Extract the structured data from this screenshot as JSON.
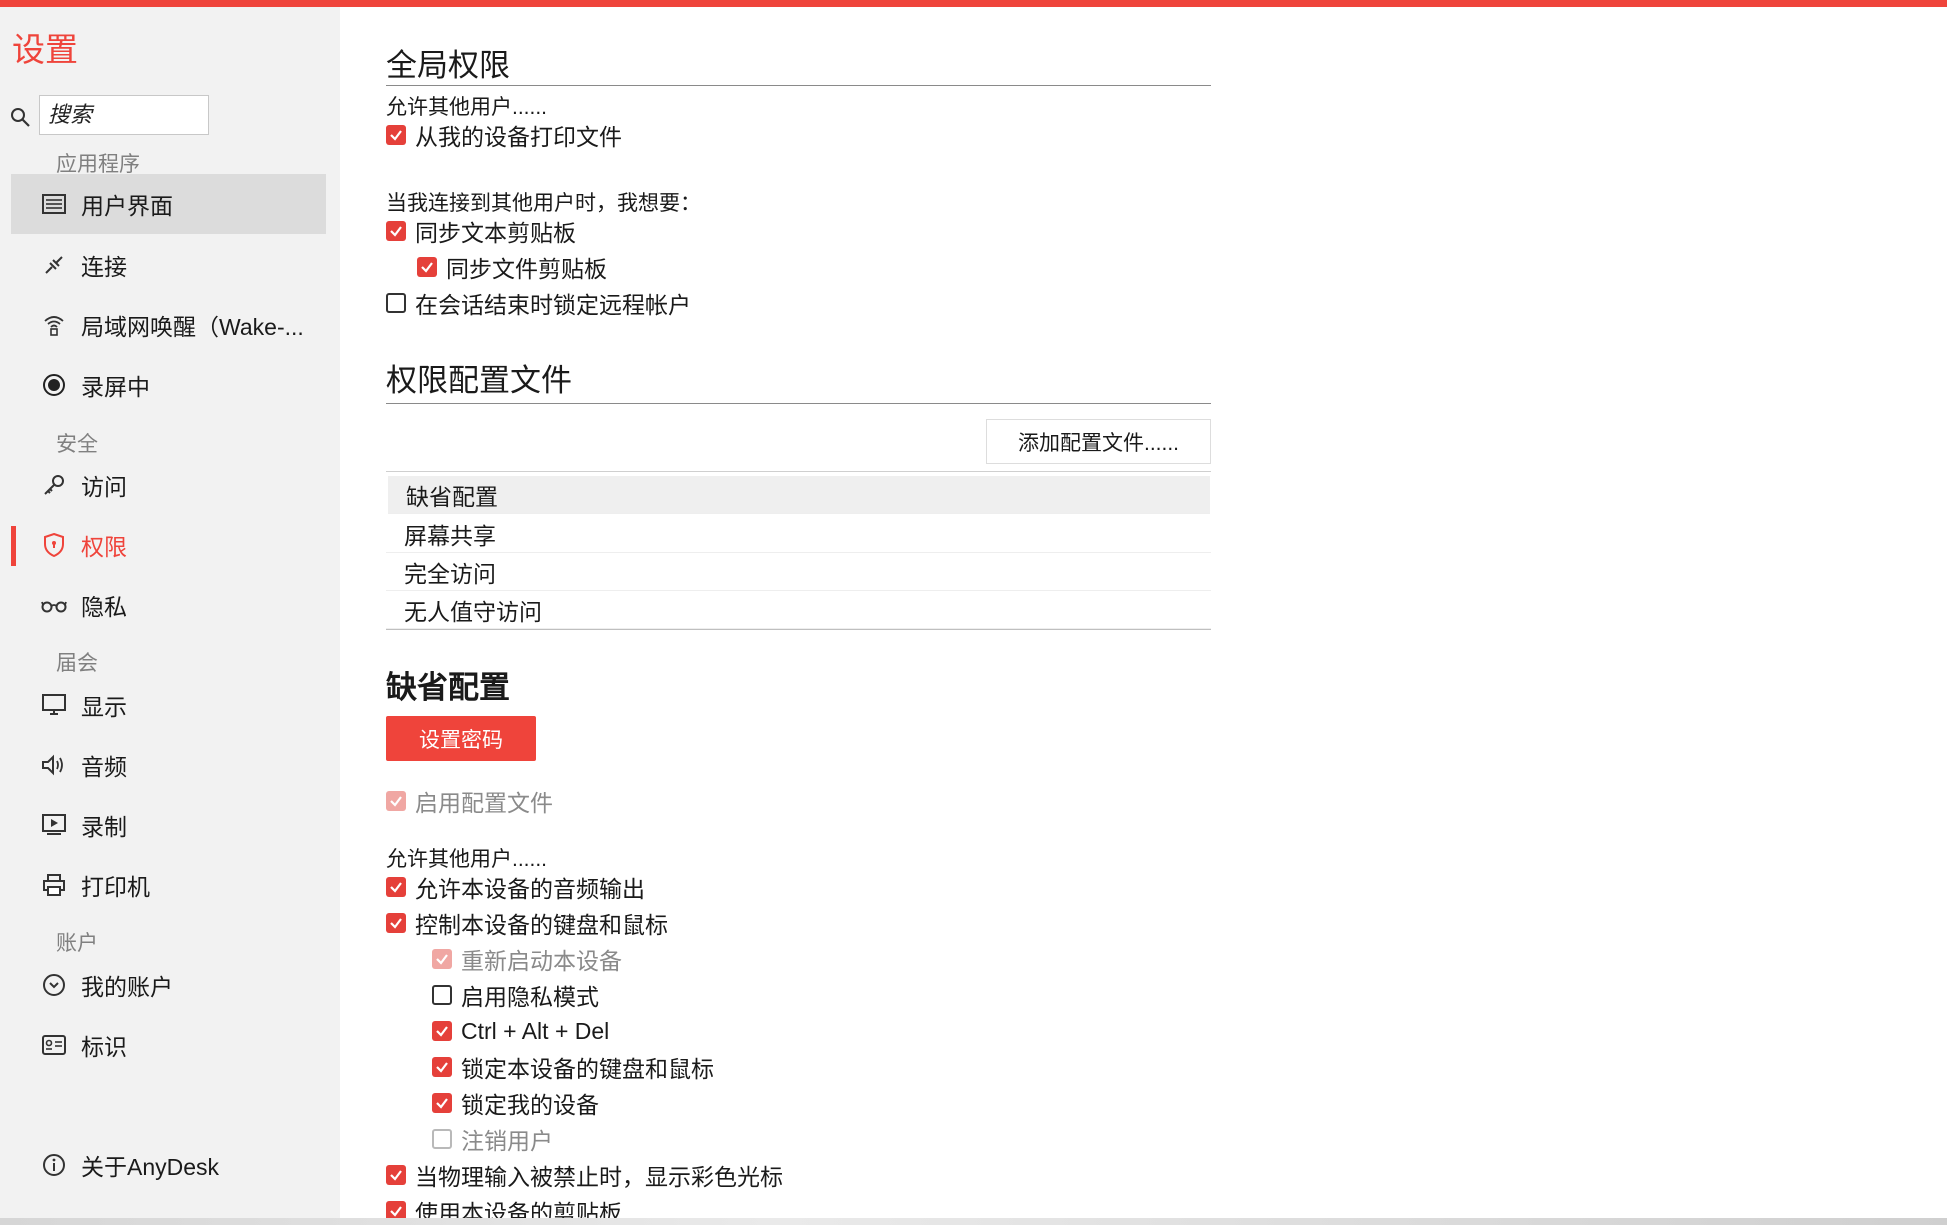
{
  "sidebar": {
    "title": "设置",
    "search": {
      "placeholder": "搜索",
      "icon": "search-icon"
    },
    "sections": [
      {
        "header": "应用程序"
      },
      {
        "header": "安全"
      },
      {
        "header": "届会"
      },
      {
        "header": "账户"
      }
    ],
    "items": [
      {
        "label": "用户界面",
        "icon": "user-interface-icon"
      },
      {
        "label": "连接",
        "icon": "connection-icon"
      },
      {
        "label": "局域网唤醒（Wake-...",
        "icon": "wake-on-lan-icon"
      },
      {
        "label": "录屏中",
        "icon": "record-icon"
      },
      {
        "label": "访问",
        "icon": "key-icon"
      },
      {
        "label": "权限",
        "icon": "shield-icon"
      },
      {
        "label": "隐私",
        "icon": "glasses-icon"
      },
      {
        "label": "显示",
        "icon": "monitor-icon"
      },
      {
        "label": "音频",
        "icon": "speaker-icon"
      },
      {
        "label": "录制",
        "icon": "video-icon"
      },
      {
        "label": "打印机",
        "icon": "printer-icon"
      },
      {
        "label": "我的账户",
        "icon": "account-icon"
      },
      {
        "label": "标识",
        "icon": "id-card-icon"
      },
      {
        "label": "关于AnyDesk",
        "icon": "info-icon"
      }
    ]
  },
  "global": {
    "title": "全局权限",
    "allow_label": "允许其他用户......",
    "print_files": "从我的设备打印文件",
    "connect_label": "当我连接到其他用户时，我想要：",
    "sync_text": "同步文本剪贴板",
    "sync_file": "同步文件剪贴板",
    "lock_remote": "在会话结束时锁定远程帐户"
  },
  "profiles": {
    "title": "权限配置文件",
    "add_button": "添加配置文件......",
    "list": [
      "缺省配置",
      "屏幕共享",
      "完全访问",
      "无人值守访问"
    ]
  },
  "default_profile": {
    "title": "缺省配置",
    "set_password": "设置密码",
    "enable_profile": "启用配置文件",
    "allow_label": "允许其他用户......",
    "options": [
      "允许本设备的音频输出",
      "控制本设备的键盘和鼠标",
      "重新启动本设备",
      "启用隐私模式",
      "Ctrl + Alt + Del",
      "锁定本设备的键盘和鼠标",
      "锁定我的设备",
      "注销用户",
      "当物理输入被禁止时，显示彩色光标",
      "使用本设备的剪贴板"
    ]
  },
  "colors": {
    "accent": "#ef443b",
    "sidebar_bg": "#f2f2f2",
    "selected_bg": "#dcdcdc"
  }
}
